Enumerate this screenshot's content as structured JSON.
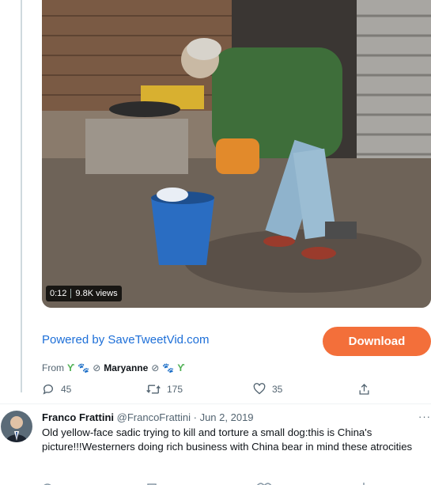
{
  "video": {
    "duration": "0:12",
    "views": "9.8K views"
  },
  "powered_by": "Powered by SaveTweetVid.com",
  "download_label": "Download",
  "from": {
    "prefix": "From",
    "name": "Maryanne"
  },
  "actions": {
    "replies": "45",
    "retweets": "175",
    "likes": "35"
  },
  "tweet": {
    "author": "Franco Frattini",
    "meta": "@FrancoFrattini · Jun 2, 2019",
    "text": "Old yellow-face sadic trying to kill and torture a small dog:this is China's picture!!!Westerners doing rich business with China bear in mind these atrocities"
  },
  "colors": {
    "accent": "#1d6fd8",
    "download": "#f36f3a",
    "muted": "#536471"
  }
}
